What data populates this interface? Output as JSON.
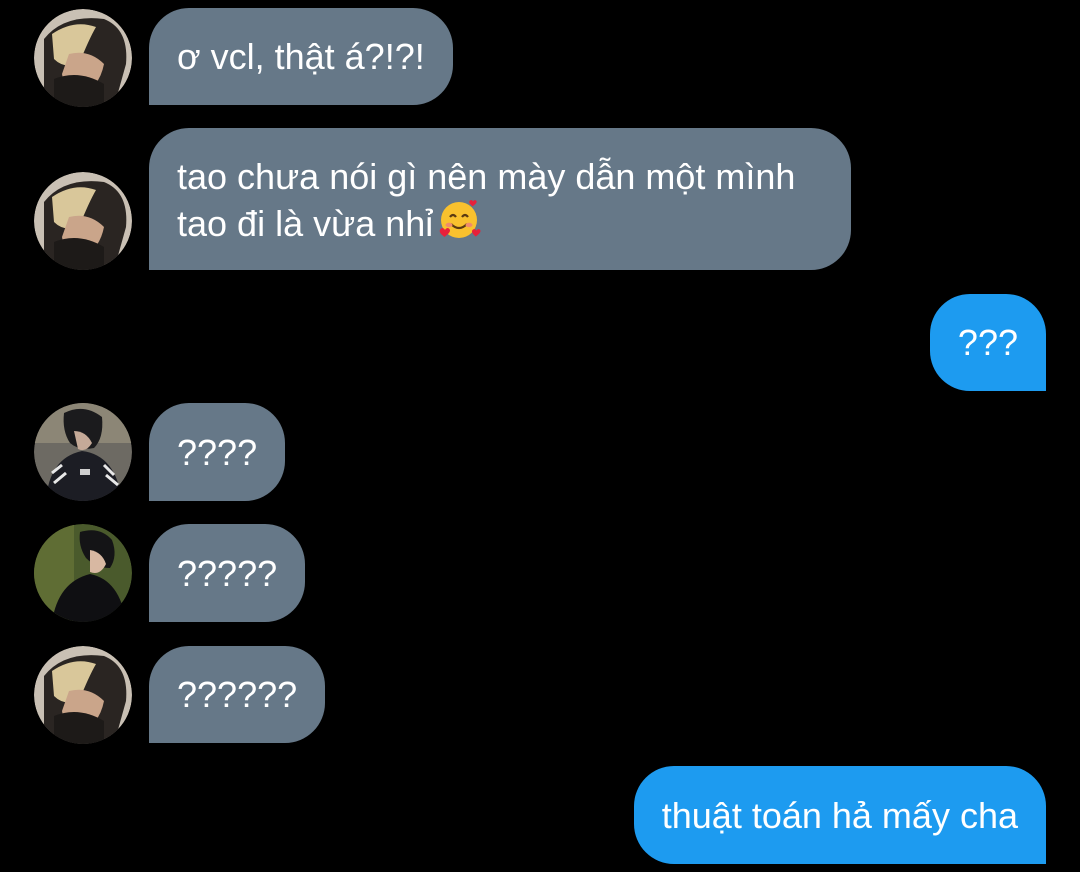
{
  "messages": [
    {
      "direction": "incoming",
      "avatar": "avatar-blonde-hair",
      "text": "ơ vcl, thật á?!?!"
    },
    {
      "direction": "incoming",
      "avatar": "avatar-blonde-hair",
      "text": "tao chưa nói gì nên mày dẫn một mình tao đi là vừa nhỉ",
      "emoji": "smiling-face-with-hearts-emoji"
    },
    {
      "direction": "outgoing",
      "text": "???"
    },
    {
      "direction": "incoming",
      "avatar": "avatar-tracksuit-guy",
      "text": "????"
    },
    {
      "direction": "incoming",
      "avatar": "avatar-dark-hair-green-bg",
      "text": "?????"
    },
    {
      "direction": "incoming",
      "avatar": "avatar-blonde-hair",
      "text": "??????"
    },
    {
      "direction": "outgoing",
      "text": "thuật toán hả mấy cha"
    }
  ],
  "colors": {
    "background": "#000000",
    "incoming_bubble": "#667888",
    "outgoing_bubble": "#1d9bf0",
    "text": "#ffffff"
  }
}
